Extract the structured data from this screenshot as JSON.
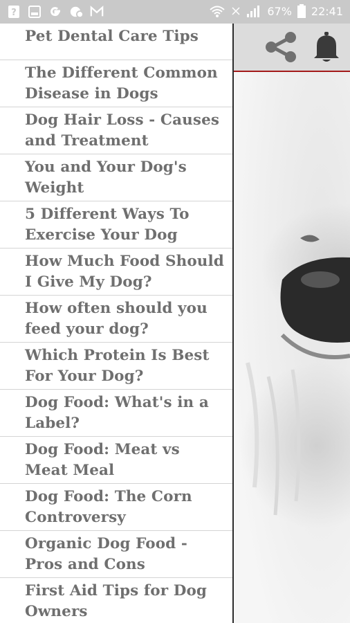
{
  "status_bar": {
    "battery": "67%",
    "time": "22:41",
    "icons": [
      "help-icon",
      "image-icon",
      "google-icon",
      "chat-icon",
      "gmail-icon",
      "wifi-icon",
      "signal-muted-icon",
      "signal-icon",
      "battery-icon"
    ]
  },
  "drawer": {
    "items": [
      "Pet Dental Care Tips",
      "The Different Common Disease in Dogs",
      "Dog Hair Loss - Causes and Treatment",
      "You and Your Dog's Weight",
      "5 Different Ways To Exercise Your Dog",
      "How Much Food Should I Give My Dog?",
      "How often should you feed your dog?",
      "Which Protein Is Best For Your Dog?",
      "Dog Food: What's in a Label?",
      "Dog Food: Meat vs Meat Meal",
      "Dog Food: The Corn Controversy",
      "Organic Dog Food - Pros and Cons",
      "First Aid Tips for Dog Owners"
    ]
  },
  "toolbar": {
    "icons": [
      "share-icon",
      "bell-icon"
    ],
    "accent_color": "#a31919"
  }
}
